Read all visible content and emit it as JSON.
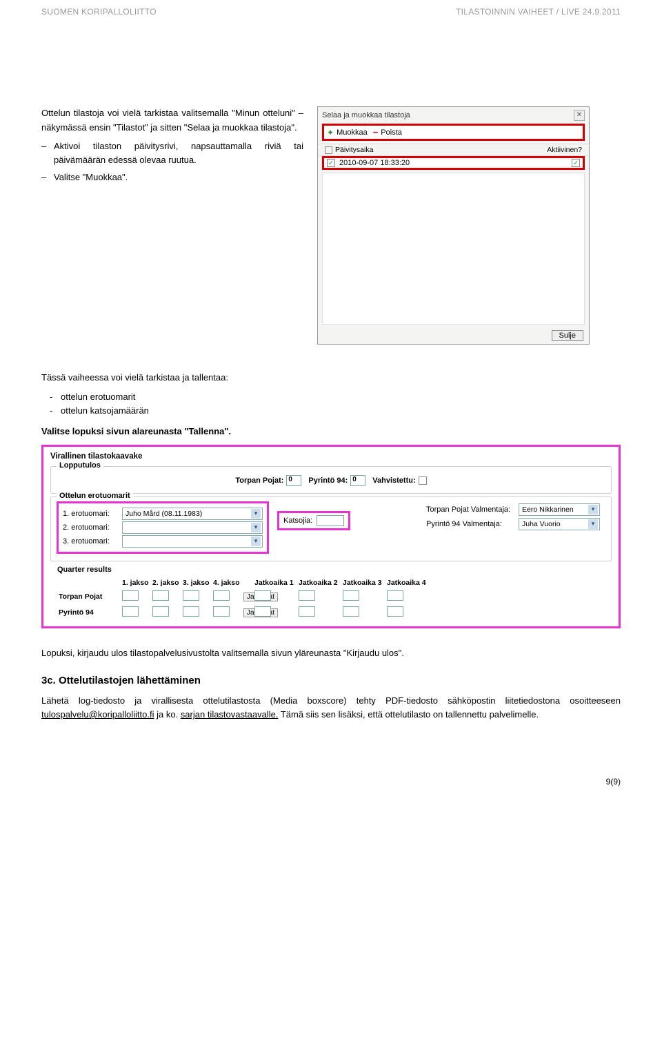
{
  "header": {
    "left": "SUOMEN KORIPALLOLIITTO",
    "right": "TILASTOINNIN VAIHEET / LIVE  24.9.2011"
  },
  "intro": {
    "p1": "Ottelun tilastoja voi vielä tarkistaa valitsemalla \"Minun otteluni\" –näkymässä ensin \"Tilastot\" ja sitten \"Selaa ja muokkaa tilastoja\".",
    "b1": "Aktivoi tilaston päivitysrivi, napsauttamalla riviä tai päivämäärän edessä olevaa ruutua.",
    "b2": "Valitse \"Muokkaa\"."
  },
  "dialog": {
    "title": "Selaa ja muokkaa tilastoja",
    "edit": "Muokkaa",
    "delete": "Poista",
    "col1": "Päivitysaika",
    "col2": "Aktiivinen?",
    "timestamp": "2010-09-07 18:33:20",
    "close": "Sulje"
  },
  "mid": {
    "p1": "Tässä vaiheessa voi vielä tarkistaa ja tallentaa:",
    "l1": "ottelun erotuomarit",
    "l2": "ottelun katsojamäärän",
    "p2": "Valitse lopuksi sivun alareunasta \"Tallenna\"."
  },
  "form": {
    "title": "Virallinen tilastokaavake",
    "lopputulos": "Lopputulos",
    "teamA": "Torpan Pojat:",
    "teamB": "Pyrintö 94:",
    "scoreA": "0",
    "scoreB": "0",
    "vahv": "Vahvistettu:",
    "erotuomarit": "Ottelun erotuomarit",
    "r1": "1. erotuomari:",
    "r2": "2. erotuomari:",
    "r3": "3. erotuomari:",
    "ref1val": "Juho Mård (08.11.1983)",
    "katsojia": "Katsojia:",
    "coachA_lbl": "Torpan Pojat Valmentaja:",
    "coachB_lbl": "Pyrintö 94 Valmentaja:",
    "coachA": "Eero Nikkarinen",
    "coachB": "Juha Vuorio",
    "qr_title": "Quarter results",
    "q1": "1. jakso",
    "q2": "2. jakso",
    "q3": "3. jakso",
    "q4": "4. jakso",
    "ot1": "Jatkoaika 1",
    "ot2": "Jatkoaika 2",
    "ot3": "Jatkoaika 3",
    "ot4": "Jatkoaika 4",
    "rowA": "Torpan Pojat",
    "rowB": "Pyrintö 94",
    "jatko": "Jatkoajat"
  },
  "after": {
    "p1": "Lopuksi, kirjaudu ulos tilastopalvelusivustolta valitsemalla sivun yläreunasta \"Kirjaudu ulos\".",
    "h3": "3c. Ottelutilastojen lähettäminen",
    "p2a": "Lähetä log-tiedosto ja virallisesta ottelutilastosta (Media boxscore) tehty PDF-tiedosto sähköpostin liitetiedostona osoitteeseen ",
    "email": "tulospalvelu@koripalloliitto.fi",
    "p2b": " ja ko. ",
    "link2": "sarjan tilastovastaavalle.",
    "p2c": " Tämä siis sen lisäksi, että ottelutilasto on tallennettu palvelimelle."
  },
  "pagenum": "9(9)"
}
